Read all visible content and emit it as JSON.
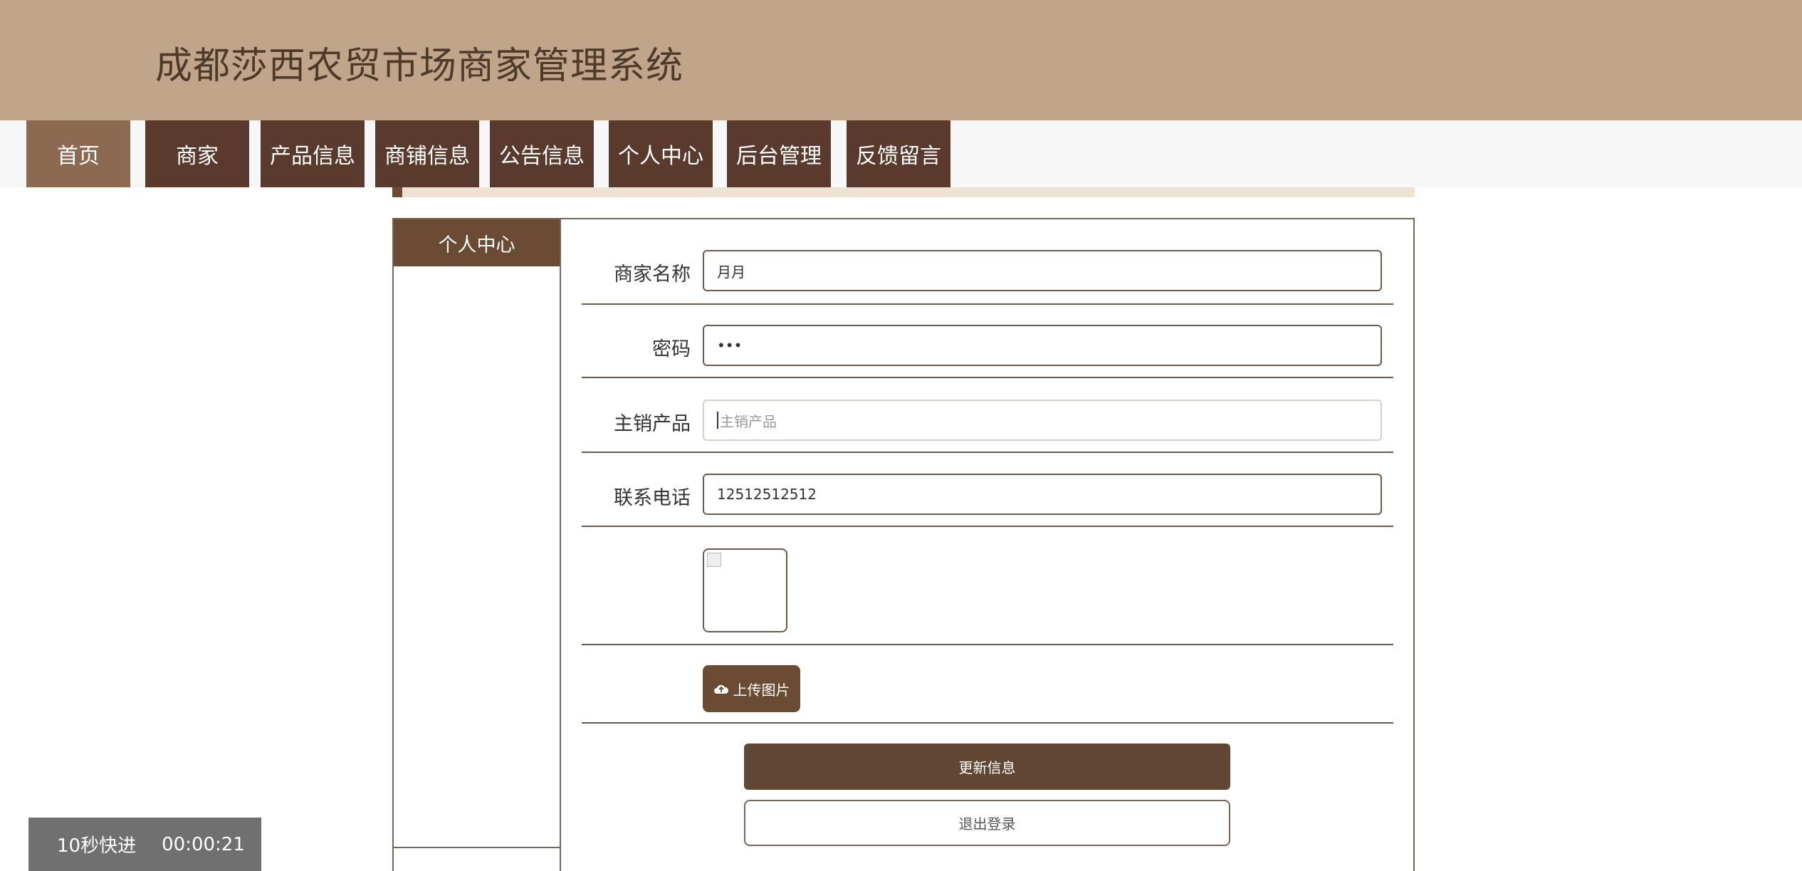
{
  "header": {
    "title": "成都莎西农贸市场商家管理系统"
  },
  "nav": {
    "items": [
      {
        "label": "首页",
        "active": true
      },
      {
        "label": "商家",
        "active": false
      },
      {
        "label": "产品信息",
        "active": false
      },
      {
        "label": "商铺信息",
        "active": false
      },
      {
        "label": "公告信息",
        "active": false
      },
      {
        "label": "个人中心",
        "active": false
      },
      {
        "label": "后台管理",
        "active": false
      },
      {
        "label": "反馈留言",
        "active": false
      }
    ]
  },
  "sidebar": {
    "title": "个人中心"
  },
  "form": {
    "merchant_name": {
      "label": "商家名称",
      "value": "月月"
    },
    "password": {
      "label": "密码",
      "value": "•••"
    },
    "main_product": {
      "label": "主销产品",
      "placeholder": "主销产品",
      "value": ""
    },
    "phone": {
      "label": "联系电话",
      "value": "12512512512"
    },
    "upload_label": "上传图片",
    "update_label": "更新信息",
    "logout_label": "退出登录"
  },
  "overlay": {
    "speed_label": "10秒快进",
    "time": "00:00:21"
  },
  "colors": {
    "header_bg": "#c0a58b",
    "nav_bg": "#5a3a2c",
    "nav_active_bg": "#8c6a52",
    "accent": "#6b4b33"
  }
}
